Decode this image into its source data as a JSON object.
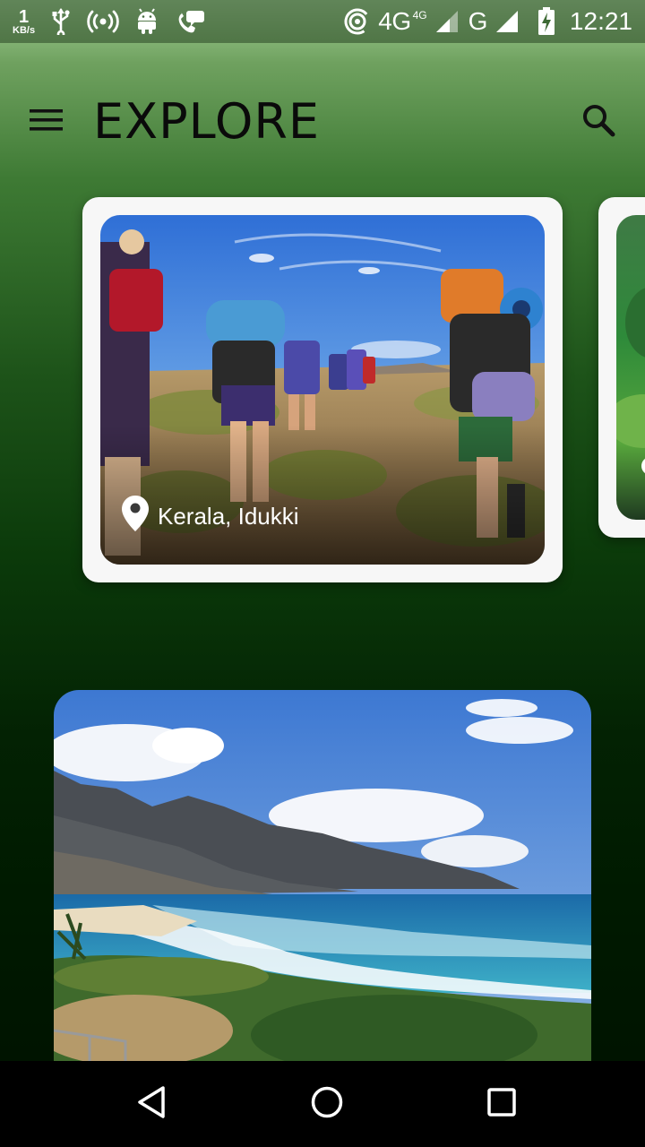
{
  "status_bar": {
    "speed_value": "1",
    "speed_unit": "KB/s",
    "network_primary": "4G",
    "network_small": "4G",
    "network_secondary": "G",
    "time": "12:21",
    "icons": [
      "usb-icon",
      "hotspot-icon",
      "android-icon",
      "call-icon",
      "wifi-calling-icon",
      "signal-icon",
      "battery-charging-icon"
    ]
  },
  "app_bar": {
    "title": "EXPLORE",
    "menu_icon": "menu-icon",
    "search_icon": "search-icon"
  },
  "cards": [
    {
      "location": "Kerala, Idukki",
      "icon": "location-pin-icon"
    }
  ],
  "nav_bar": {
    "icons": [
      "back-icon",
      "home-icon",
      "recents-icon"
    ]
  },
  "colors": {
    "background_top": "#a6d39a",
    "background_bottom": "#001400",
    "card": "#f7f7f7",
    "title": "#0a0a0a"
  }
}
